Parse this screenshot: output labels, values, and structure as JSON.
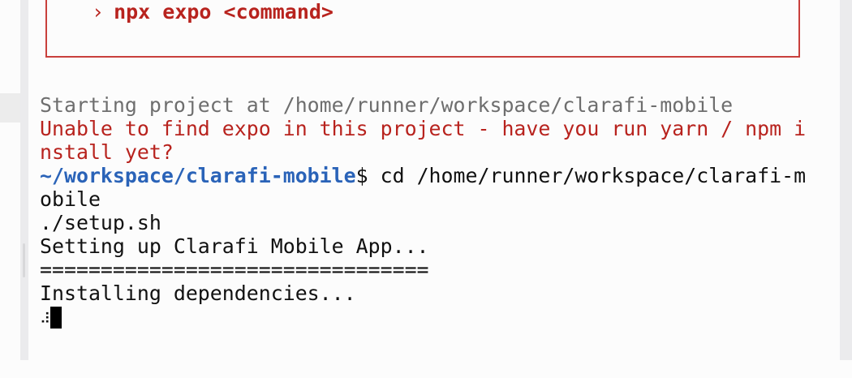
{
  "error_box": {
    "prompt_glyph": "›",
    "command": "npx expo <command>"
  },
  "terminal": {
    "lines": {
      "starting": "Starting project at /home/runner/workspace/clarafi-mobile",
      "error_1": "Unable to find expo in this project - have you run yarn / npm i",
      "error_2": "nstall yet?",
      "prompt_path": "~/workspace/clarafi-mobile",
      "prompt_symbol": "$",
      "command_1": " cd /home/runner/workspace/clarafi-m",
      "command_2": "obile",
      "setup": "./setup.sh",
      "setting_up": "Setting up Clarafi Mobile App...",
      "separator": "================================",
      "installing": "Installing dependencies...",
      "spinner": "⠼"
    }
  },
  "colors": {
    "error": "#b8231e",
    "path": "#2a63b8",
    "dim": "#6e6e6e",
    "text": "#111111"
  }
}
